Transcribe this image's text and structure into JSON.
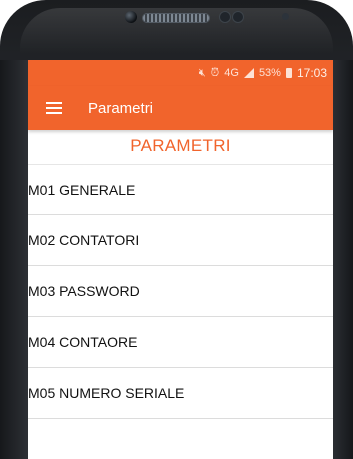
{
  "status_bar": {
    "icons": [
      "mute-icon",
      "alarm-icon",
      "4g-icon",
      "signal-icon"
    ],
    "network_label": "4G",
    "battery": "53%",
    "time": "17:03"
  },
  "app_bar": {
    "title": "Parametri"
  },
  "page": {
    "heading": "PARAMETRI"
  },
  "menu": [
    {
      "label": "M01 GENERALE"
    },
    {
      "label": "M02 CONTATORI"
    },
    {
      "label": "M03 PASSWORD"
    },
    {
      "label": "M04 CONTAORE"
    },
    {
      "label": "M05 NUMERO SERIALE"
    }
  ],
  "colors": {
    "accent": "#f1642c",
    "text": "#111111"
  }
}
